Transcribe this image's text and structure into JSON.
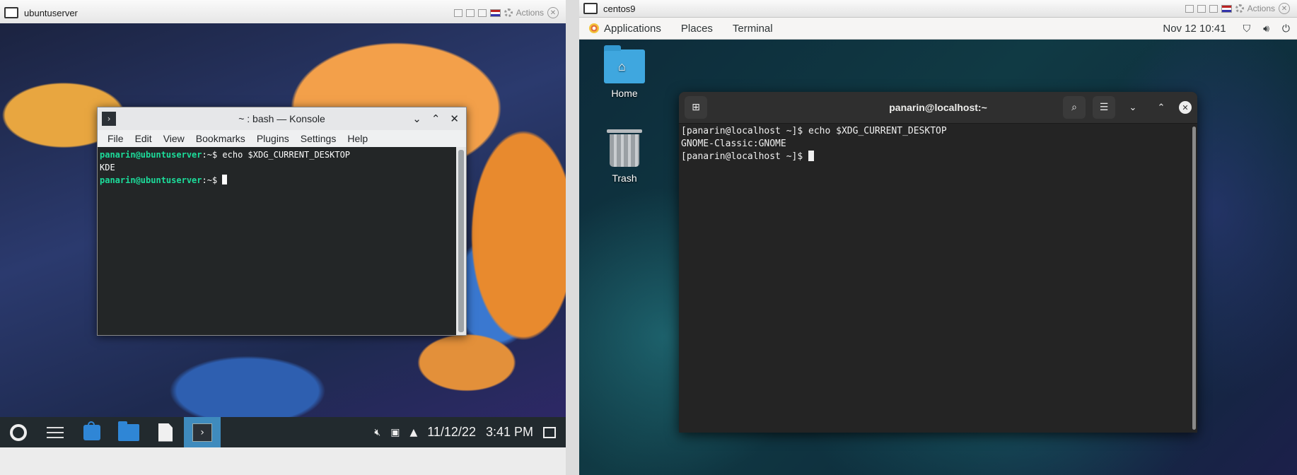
{
  "left_vm": {
    "title": "ubuntuserver",
    "actions_label": "Actions",
    "konsole": {
      "title": "~ : bash — Konsole",
      "menu": [
        "File",
        "Edit",
        "View",
        "Bookmarks",
        "Plugins",
        "Settings",
        "Help"
      ],
      "prompt": "panarin@ubuntuserver",
      "prompt_suffix": ":~$ ",
      "command": "echo $XDG_CURRENT_DESKTOP",
      "output": "KDE"
    },
    "taskbar": {
      "icons": [
        "kde-launcher-icon",
        "system-settings-icon",
        "discover-icon",
        "dolphin-icon",
        "text-editor-icon",
        "konsole-icon"
      ],
      "date": "11/12/22",
      "time": "3:41 PM"
    }
  },
  "right_vm": {
    "title": "centos9",
    "actions_label": "Actions",
    "topbar": {
      "menus": [
        "Applications",
        "Places",
        "Terminal"
      ],
      "clock": "Nov 12  10:41"
    },
    "desktop_icons": [
      "Home",
      "Trash"
    ],
    "terminal": {
      "title": "panarin@localhost:~",
      "prompt": "[panarin@localhost ~]$ ",
      "command": "echo $XDG_CURRENT_DESKTOP",
      "output": "GNOME-Classic:GNOME"
    }
  }
}
